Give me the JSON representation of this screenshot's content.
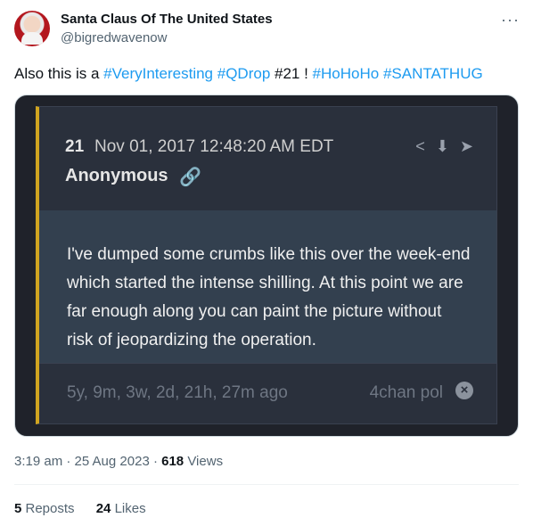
{
  "user": {
    "name": "Santa Claus Of The United States",
    "handle": "@bigredwavenow"
  },
  "tweet": {
    "text_prefix": "Also this is a ",
    "tag1": "#VeryInteresting",
    "tag2": "#QDrop",
    "mid": " #21 ! ",
    "tag3": "#HoHoHo",
    "tag4": "#SANTATHUG"
  },
  "post": {
    "number": "21",
    "date": "Nov 01, 2017 12:48:20 AM EDT",
    "author": "Anonymous",
    "body": "I've dumped some crumbs like this over the week-end which started the intense shilling. At this point we are far enough along you can paint the picture without risk of jeopardizing the operation.",
    "ago": "5y, 9m, 3w, 2d, 21h, 27m ago",
    "board": "4chan pol"
  },
  "meta": {
    "time": "3:19 am · 25 Aug 2023 · ",
    "views_count": "618",
    "views_label": " Views"
  },
  "stats": {
    "reposts_count": "5",
    "reposts_label": " Reposts",
    "likes_count": "24",
    "likes_label": " Likes"
  },
  "icons": [
    "more-icon",
    "share-icon",
    "download-icon",
    "forward-icon",
    "link-icon",
    "close-icon"
  ]
}
